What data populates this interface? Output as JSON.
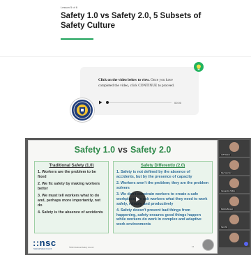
{
  "lesson": {
    "label": "Lesson 5 of 6",
    "title": "Safety 1.0 vs Safety 2.0, 5 Subsets of Safety Culture"
  },
  "callout": {
    "instruction_bold": "Click on the video below to view.",
    "instruction_rest": " Once you have completed the video, click CONTINUE to proceed.",
    "player": {
      "time": "00:00",
      "progress": 0
    }
  },
  "video": {
    "slide": {
      "title_left": "Safety 1.0",
      "title_vs": "vs",
      "title_right": "Safety 2.0",
      "left_box": {
        "heading": "Traditional Safety (1.0)",
        "items": [
          "1. Workers are the problem to be fixed",
          "2. We fix safety by making workers better",
          "3. We must tell workers what to do and, perhaps more importantly, not do",
          "4. Safety is the absence of accidents"
        ]
      },
      "right_box": {
        "heading": "Safety Differently (2.0)",
        "items": [
          "1. Safety is not defined by the absence of accidents, but by the presence of capacity",
          "2. Workers aren't the problem; they are the problem solvers",
          "3. We don't constrain workers to create a safe workplace, we ask workers what they need to work safely, reliably and productively",
          "4. Safety doesn't prevent bad things from happening, safety ensures good things happen while workers do work in complex and adaptive work environments"
        ]
      },
      "logo": "::nsc",
      "logo_sub": "National Safety Council",
      "footer": "©2023 National Safety Council",
      "page_number": "11"
    },
    "participants": [
      {
        "name": "Jeff Walters"
      },
      {
        "name": "Ray Sanchez"
      },
      {
        "name": "Cassandra Hollins"
      },
      {
        "name": "Patricia Bennet"
      },
      {
        "name": "Tom Hill"
      },
      {
        "name": ""
      }
    ]
  },
  "colors": {
    "accent_green": "#1fa35b",
    "slide_title_green": "#2f8a4a",
    "nsc_blue": "#0b3f7a",
    "badge_navy": "#1e3b78"
  },
  "icons": [
    "lightbulb-icon",
    "play-icon",
    "safety-badge-icon",
    "play-overlay-icon"
  ]
}
